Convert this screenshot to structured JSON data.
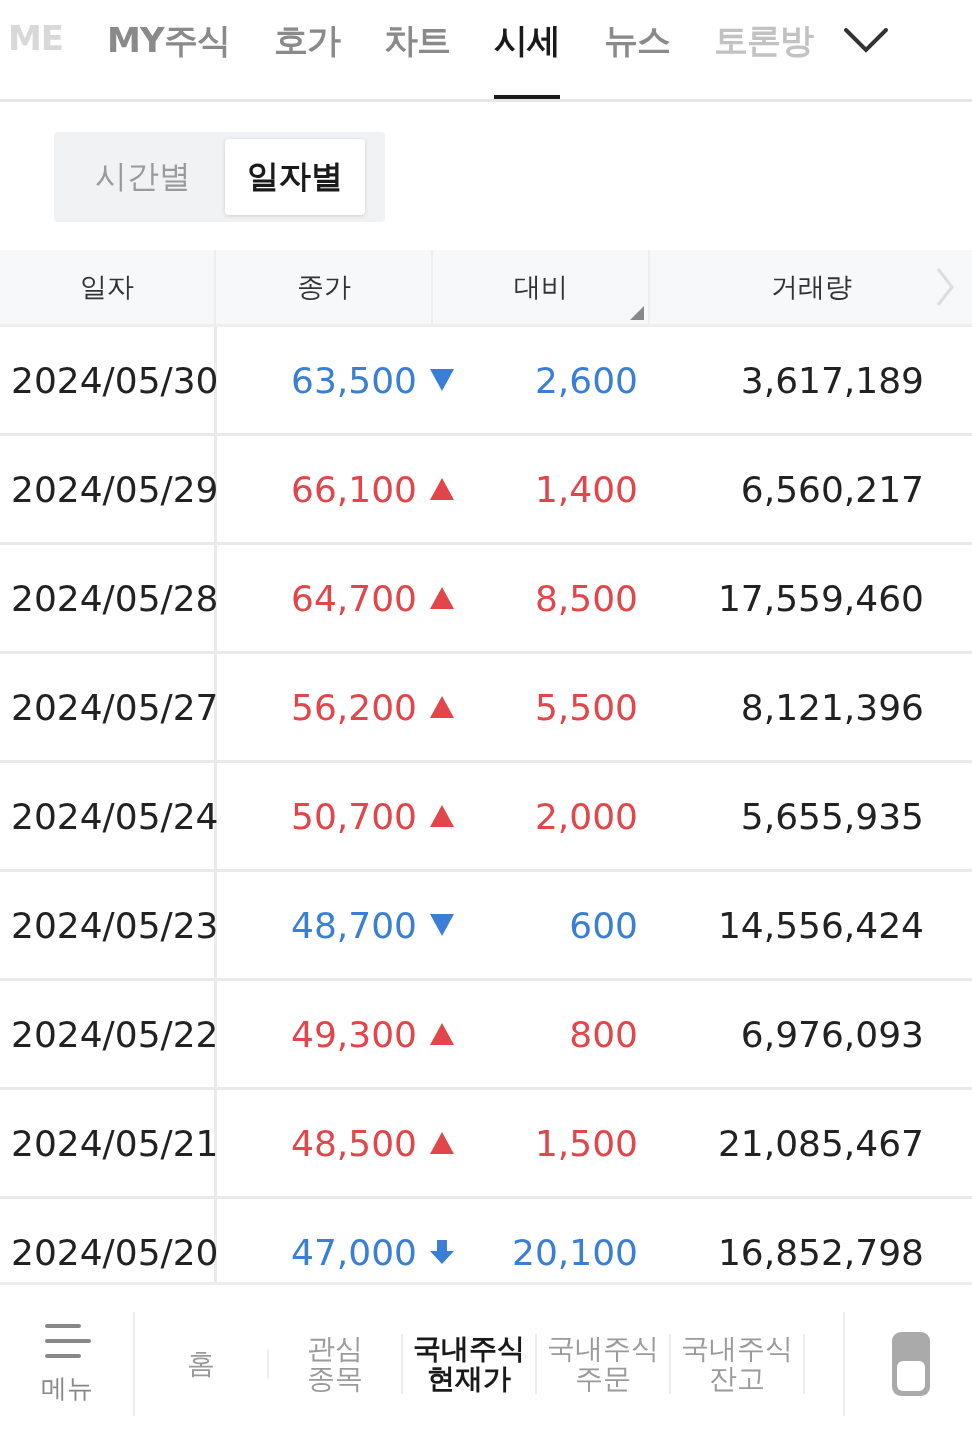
{
  "tabs": [
    {
      "label": "ME",
      "selected": false,
      "faded": true
    },
    {
      "label": "MY주식",
      "selected": false,
      "faded": false
    },
    {
      "label": "호가",
      "selected": false,
      "faded": false
    },
    {
      "label": "차트",
      "selected": false,
      "faded": false
    },
    {
      "label": "시세",
      "selected": true,
      "faded": false
    },
    {
      "label": "뉴스",
      "selected": false,
      "faded": false
    },
    {
      "label": "토론방",
      "selected": false,
      "faded": true
    }
  ],
  "segments": [
    {
      "label": "시간별",
      "selected": false
    },
    {
      "label": "일자별",
      "selected": true
    }
  ],
  "table": {
    "columns": [
      "일자",
      "종가",
      "대비",
      "거래량"
    ],
    "rows": [
      {
        "date": "2024/05/30",
        "close": "63,500",
        "kind": "down",
        "change": "2,600",
        "volume": "3,617,189"
      },
      {
        "date": "2024/05/29",
        "close": "66,100",
        "kind": "up",
        "change": "1,400",
        "volume": "6,560,217"
      },
      {
        "date": "2024/05/28",
        "close": "64,700",
        "kind": "up",
        "change": "8,500",
        "volume": "17,559,460"
      },
      {
        "date": "2024/05/27",
        "close": "56,200",
        "kind": "up",
        "change": "5,500",
        "volume": "8,121,396"
      },
      {
        "date": "2024/05/24",
        "close": "50,700",
        "kind": "up",
        "change": "2,000",
        "volume": "5,655,935"
      },
      {
        "date": "2024/05/23",
        "close": "48,700",
        "kind": "down",
        "change": "600",
        "volume": "14,556,424"
      },
      {
        "date": "2024/05/22",
        "close": "49,300",
        "kind": "up",
        "change": "800",
        "volume": "6,976,093"
      },
      {
        "date": "2024/05/21",
        "close": "48,500",
        "kind": "up",
        "change": "1,500",
        "volume": "21,085,467"
      },
      {
        "date": "2024/05/20",
        "close": "47,000",
        "kind": "limit_down",
        "change": "20,100",
        "volume": "16,852,798"
      }
    ]
  },
  "bottom_nav": {
    "menu_label": "메뉴",
    "items": [
      {
        "label": "홈",
        "selected": false
      },
      {
        "label": "관심\n종목",
        "selected": false
      },
      {
        "label": "국내주식\n현재가",
        "selected": true
      },
      {
        "label": "국내주식\n주문",
        "selected": false
      },
      {
        "label": "국내주식\n잔고",
        "selected": false
      }
    ]
  }
}
